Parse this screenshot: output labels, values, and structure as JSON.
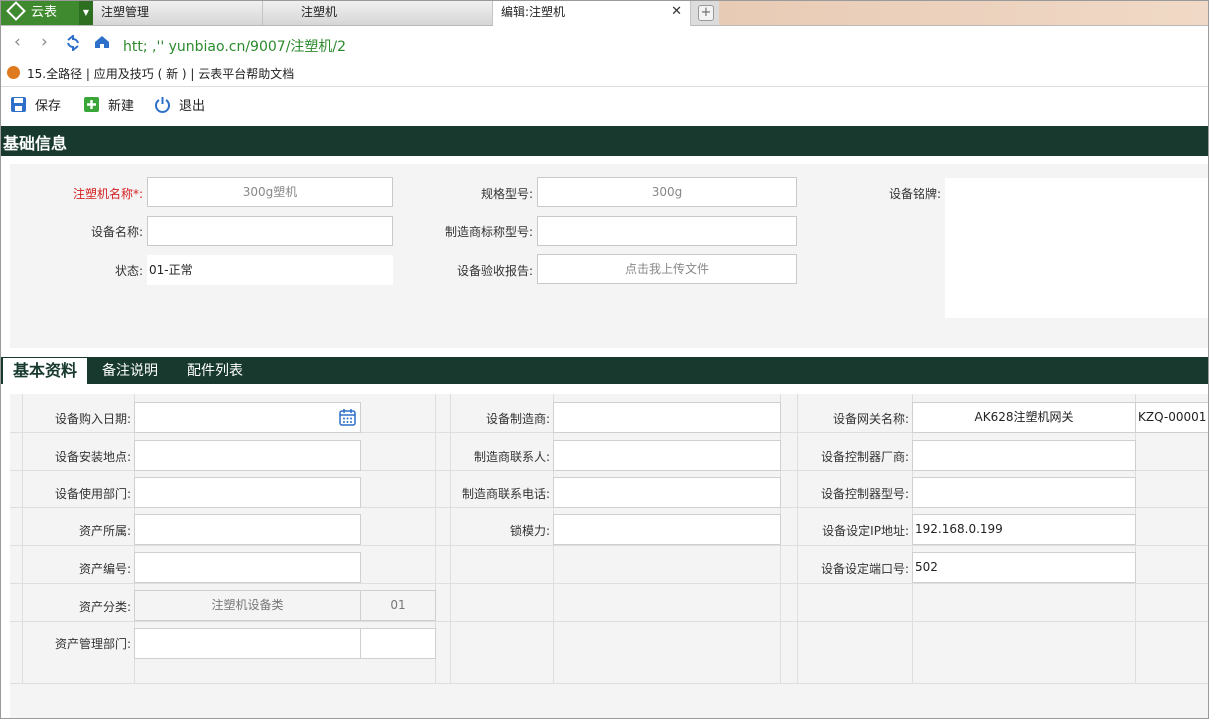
{
  "app": {
    "name": "云表"
  },
  "tabs": [
    {
      "label": "注塑管理"
    },
    {
      "label": "注塑机"
    },
    {
      "label": "编辑:注塑机"
    }
  ],
  "address": "htt;  ,'' yunbiao.cn/9007/注塑机/2",
  "bookmarks": "15.全路径 | 应用及技巧 ( 新 ) | 云表平台帮助文档",
  "toolbar": {
    "save": "保存",
    "new": "新建",
    "exit": "退出"
  },
  "section": {
    "title": "基础信息"
  },
  "basic": {
    "machine_name_label": "注塑机名称*:",
    "machine_name_value": "300g塑机",
    "spec_label": "规格型号:",
    "spec_value": "300g",
    "plate_label": "设备铭牌:",
    "device_name_label": "设备名称:",
    "mfr_model_label": "制造商标称型号:",
    "status_label": "状态:",
    "status_value": "01-正常",
    "report_label": "设备验收报告:",
    "report_value": "点击我上传文件"
  },
  "subtabs": [
    {
      "label": "基本资料"
    },
    {
      "label": "备注说明"
    },
    {
      "label": "配件列表"
    }
  ],
  "detail": {
    "purchase_date": "设备购入日期:",
    "install_location": "设备安装地点:",
    "use_dept": "设备使用部门:",
    "asset_owner": "资产所属:",
    "asset_no": "资产编号:",
    "asset_class": "资产分类:",
    "asset_class_value": "注塑机设备类",
    "asset_class_code": "01",
    "asset_dept": "资产管理部门:",
    "manufacturer": "设备制造商:",
    "mfr_contact": "制造商联系人:",
    "mfr_phone": "制造商联系电话:",
    "clamp_force": "锁模力:",
    "gateway_name": "设备网关名称:",
    "gateway_value": "AK628注塑机网关",
    "gateway_code": "KZQ-00001",
    "controller_mfr": "设备控制器厂商:",
    "controller_model": "设备控制器型号:",
    "ip_label": "设备设定IP地址:",
    "ip_value": "192.168.0.199",
    "port_label": "设备设定端口号:",
    "port_value": "502"
  },
  "colors": {
    "header": "#17392e",
    "accent": "#3f8a2e",
    "required": "#d42020"
  }
}
